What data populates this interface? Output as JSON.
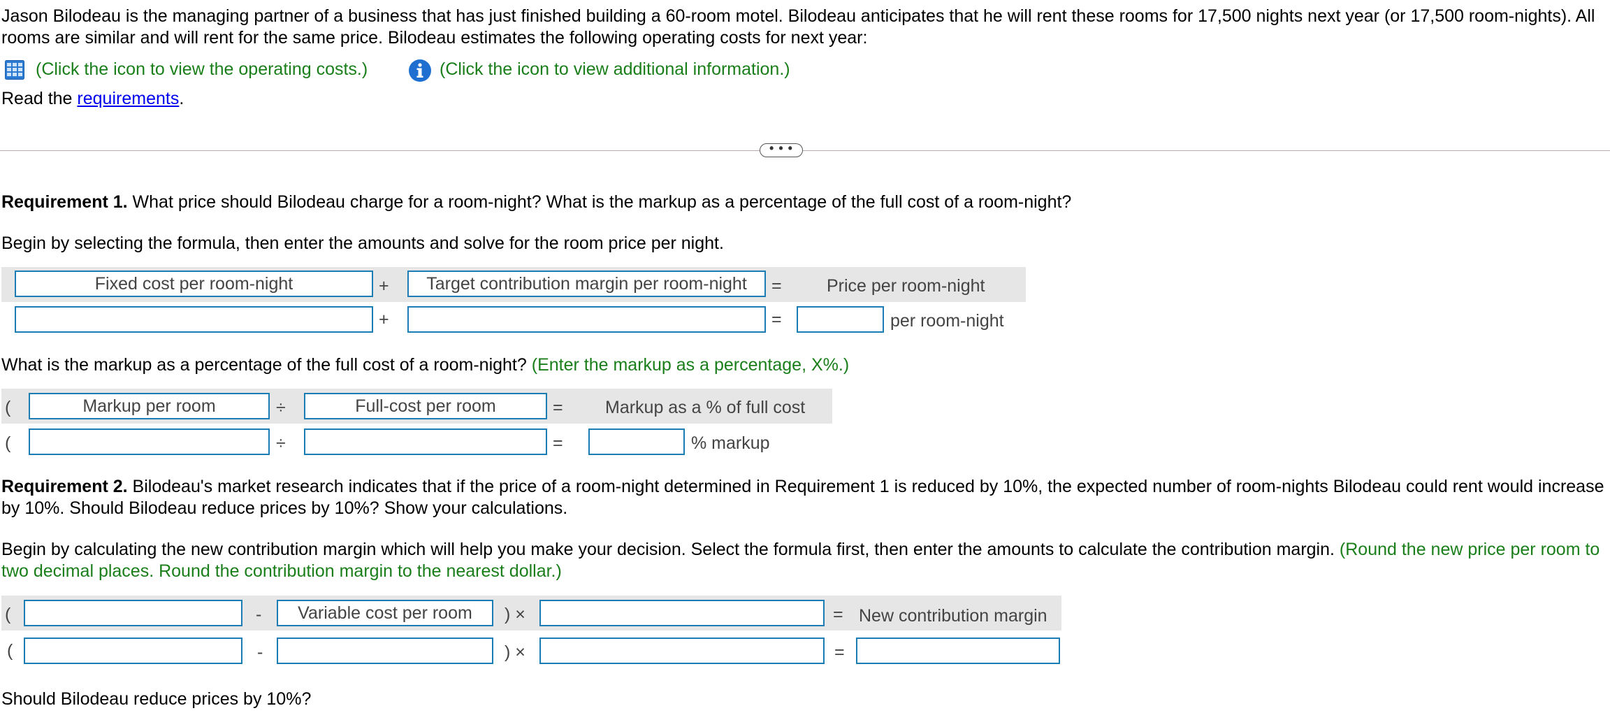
{
  "intro": {
    "paragraph": "Jason Bilodeau is the managing partner of a business that has just finished building a 60-room motel. Bilodeau anticipates that he will rent these rooms for 17,500 nights next year (or 17,500 room-nights). All rooms are similar and will rent for the same price. Bilodeau estimates the following operating costs for next year:",
    "operating_costs_link": "(Click the icon to view the operating costs.)",
    "additional_info_link": "(Click the icon to view additional information.)",
    "read_the": "Read the",
    "requirements_link": "requirements",
    "period": "."
  },
  "expander": {
    "label": "• • •"
  },
  "req1": {
    "heading": "Requirement 1.",
    "question": " What price should Bilodeau charge for a room-night? What is the markup as a percentage of the full cost of a room-night?",
    "instruction": "Begin by selecting the formula, then enter the amounts and solve for the room price per night.",
    "formula": {
      "term1": "Fixed cost per room-night",
      "op1": "+",
      "term2": "Target contribution margin per room-night",
      "eq": "=",
      "result": "Price per room-night"
    },
    "answer_row": {
      "op1": "+",
      "eq": "=",
      "input1": "",
      "input2": "",
      "result": "",
      "unit": "per room-night"
    },
    "markup_question": "What is the markup as a percentage of the full cost of a room-night?",
    "markup_hint": "(Enter the markup as a percentage, X%.)",
    "markup_formula": {
      "paren": "(",
      "term1": "Markup per room",
      "op": "÷",
      "term2": "Full-cost per room",
      "eq": "=",
      "result": "Markup as a % of full cost"
    },
    "markup_answer": {
      "paren": "(",
      "op": "÷",
      "eq": "=",
      "input1": "",
      "input2": "",
      "result": "",
      "unit": "% markup"
    }
  },
  "req2": {
    "heading": "Requirement 2.",
    "question": " Bilodeau's market research indicates that if the price of a room-night determined in Requirement 1 is reduced by 10%, the expected number of room-nights Bilodeau could rent would increase by 10%. Should Bilodeau reduce prices by 10%? Show your calculations.",
    "instruction": "Begin by calculating the new contribution margin which will help you make your decision. Select the formula first, then enter the amounts to calculate the contribution margin.",
    "instruction_hint": "(Round the new price per room to two decimal places. Round the contribution margin to the nearest dollar.)",
    "formula": {
      "paren": "(",
      "term1": "",
      "minus": "-",
      "term2": "Variable cost per room",
      "times": ") ×",
      "term3": "",
      "eq": "=",
      "result": "New contribution margin"
    },
    "answer_row": {
      "paren": "(",
      "minus": "-",
      "times": ") ×",
      "eq": "=",
      "input1": "",
      "input2": "",
      "input3": "",
      "result": ""
    },
    "final_question": "Should Bilodeau reduce prices by 10%?"
  },
  "colors": {
    "green_hint": "#1a7f1a",
    "input_border": "#1a7db3",
    "formula_bg": "#e6e6e6",
    "link": "#0000ee"
  }
}
